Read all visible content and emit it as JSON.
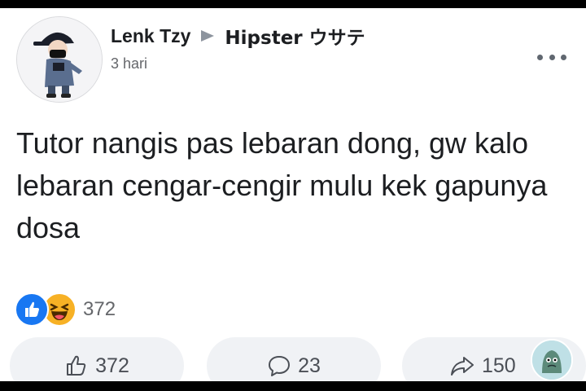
{
  "post": {
    "author": "Lenk Tzy",
    "group": "Hipster ウサテ",
    "timestamp": "3 hari",
    "text": "Tutor nangis pas lebaran dong, gw kalo lebaran cengar-cengir mulu kek gapunya dosa"
  },
  "reactions": {
    "types": [
      "like-icon",
      "haha-icon"
    ],
    "count": "372"
  },
  "actions": {
    "like_count": "372",
    "comment_count": "23",
    "share_count": "150"
  },
  "colors": {
    "like_blue": "#1877f2",
    "haha_yellow": "#f7b125",
    "text_primary": "#1c1e21",
    "text_secondary": "#65676b",
    "pill_bg": "#f0f2f5"
  }
}
